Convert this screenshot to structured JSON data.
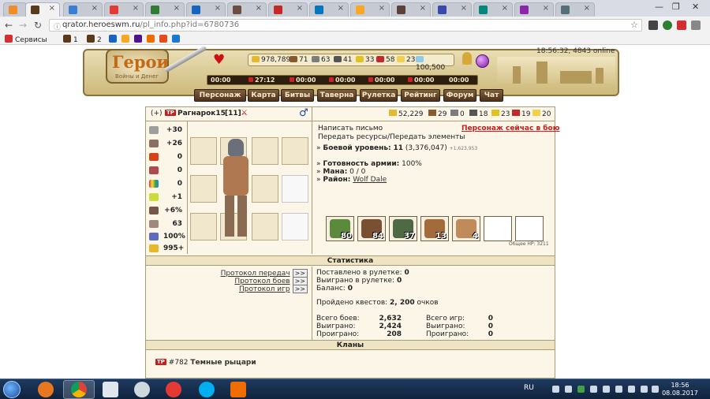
{
  "browser": {
    "tabs": [
      {
        "close": "×"
      },
      {
        "close": "×"
      },
      {
        "close": "×"
      },
      {
        "close": "×"
      },
      {
        "close": "×"
      },
      {
        "close": "×"
      },
      {
        "close": "×"
      },
      {
        "close": "×"
      },
      {
        "close": "×"
      },
      {
        "close": "×"
      },
      {
        "close": "×"
      },
      {
        "close": "×"
      },
      {
        "close": "×"
      },
      {
        "close": "×"
      },
      {
        "close": "×"
      }
    ],
    "url_host": "qrator.heroeswm.ru",
    "url_path": "/pl_info.php?id=6780736",
    "bookmarks": {
      "apps": "Сервисы",
      "bm1": "1",
      "bm2": "2"
    }
  },
  "header": {
    "logo_title": "Герои",
    "logo_sub": "Войны и Денег",
    "resources": [
      "978,789",
      "71",
      "63",
      "41",
      "33",
      "58",
      "23",
      "100,500"
    ],
    "server_time": "18:56:32, 4843 online",
    "timers": [
      "00:00",
      "27:12",
      "00:00",
      "00:00",
      "00:00",
      "00:00",
      "00:00"
    ],
    "menu": [
      "Персонаж",
      "Карта",
      "Битвы",
      "Таверна",
      "Рулетка",
      "Рейтинг",
      "Форум",
      "Чат"
    ]
  },
  "profile": {
    "plus": "(+)",
    "tag": "ТР",
    "name": "Рагнарок15",
    "level": "[11]",
    "gender": "♂",
    "res": [
      "52,229",
      "29",
      "0",
      "18",
      "23",
      "19",
      "20"
    ],
    "stats": [
      "+30",
      "+26",
      "0",
      "0",
      "0",
      "+1",
      "+6%",
      "63",
      "100%",
      "995+"
    ],
    "links": {
      "write": "Написать письмо",
      "transfer": "Передать ресурсы/Передать элементы",
      "in_battle": "Персонаж сейчас в бою"
    },
    "info": {
      "combat_label": "Боевой уровень:",
      "combat_value": "11",
      "combat_exp": "(3,376,047)",
      "combat_plus": "+1,623,953",
      "army_label": "Готовность армии:",
      "army_value": "100%",
      "mana_label": "Мана:",
      "mana_value": "0 / 0",
      "district_label": "Район:",
      "district_value": "Wolf Dale"
    },
    "army": [
      "80",
      "84",
      "37",
      "13",
      "4"
    ],
    "total_hp": "Общее HP: 3211"
  },
  "statistics": {
    "title": "Статистика",
    "protocols": [
      "Протокол передач",
      "Протокол боев",
      "Протокол игр"
    ],
    "proto_btn": ">>",
    "roulette_bet_label": "Поставлено в рулетке:",
    "roulette_bet": "0",
    "roulette_won_label": "Выиграно в рулетке:",
    "roulette_won": "0",
    "balance_label": "Баланс:",
    "balance": "0",
    "quests_label": "Пройдено квестов:",
    "quests_value": "2, 200",
    "quests_unit": "очков",
    "battles_total_label": "Всего боев:",
    "battles_total": "2,632",
    "battles_won_label": "Выиграно:",
    "battles_won": "2,424",
    "battles_lost_label": "Проиграно:",
    "battles_lost": "208",
    "games_total_label": "Всего игр:",
    "games_total": "0",
    "games_won_label": "Выиграно:",
    "games_won": "0",
    "games_lost_label": "Проиграно:",
    "games_lost": "0"
  },
  "clans": {
    "title": "Кланы",
    "tag": "ТР",
    "number": "#782",
    "name": "Темные рыцари"
  },
  "taskbar": {
    "lang": "RU",
    "time": "18:56",
    "date": "08.08.2017"
  },
  "colors": {
    "accent_red": "#c91c1c",
    "panel_bg": "#fbf6e8",
    "border": "#a89c78"
  }
}
